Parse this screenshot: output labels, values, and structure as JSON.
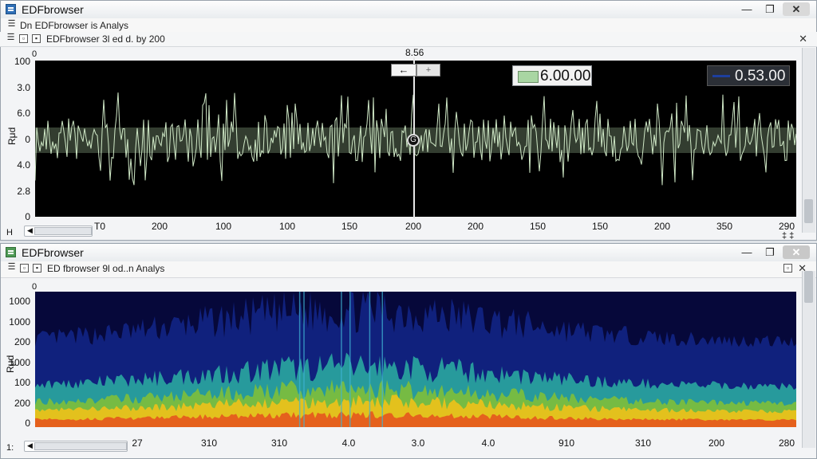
{
  "window1": {
    "title": "EDFbrowser",
    "toolbar_text": "Dn EDFbrowser is Analys",
    "tab_text": "EDFbrowser 3l ed d. by 200",
    "y_axis_label": "Rμd",
    "y_ticks": [
      "100",
      "3.0",
      "6.0",
      "0",
      "4.0",
      "2.8",
      "0"
    ],
    "x_ticks": [
      "T0",
      "200",
      "100",
      "100",
      "150",
      "200",
      "200",
      "150",
      "150",
      "200",
      "350",
      "290"
    ],
    "top_left_tick": "0",
    "cursor_label": "8.56",
    "arrow_label": "←",
    "step_label": "+",
    "cursor_symbol": "G",
    "value_box_1": "6.00.00",
    "value_box_2": "0.53.00",
    "bottom_left_label": "H",
    "bottom_right_label": "‡ ‡",
    "scroll_left_label": "◀"
  },
  "window2": {
    "title": "EDFbrowser",
    "toolbar_text": "ED fbrowser 9l od..n Analys",
    "y_axis_label": "Rμd",
    "y_ticks": [
      "1000",
      "1000",
      "200",
      "1000",
      "100",
      "200",
      "0"
    ],
    "top_left_tick": "0",
    "x_ticks": [
      "27",
      "310",
      "310",
      "4.0",
      "3.0",
      "4.0",
      "910",
      "310",
      "200",
      "280"
    ],
    "bottom_left_label": "1:",
    "scroll_left_label": "◀"
  },
  "window_buttons": {
    "minimize": "—",
    "maximize": "❐",
    "close": "✕"
  },
  "colors": {
    "signal": "#cfe8c6",
    "spectrogram_low": "#0b1a70",
    "spectrogram_mid": "#2aa7a0",
    "spectrogram_high": "#f0c21a",
    "spectrogram_peak": "#e4561e",
    "value_box_1_swatch": "#a9d6a3",
    "value_box_2_swatch": "#1d3f9e"
  },
  "icons": [
    "app-icon",
    "list-icon",
    "zoom-icon",
    "save-icon",
    "close-icon",
    "arrow-left-icon"
  ]
}
